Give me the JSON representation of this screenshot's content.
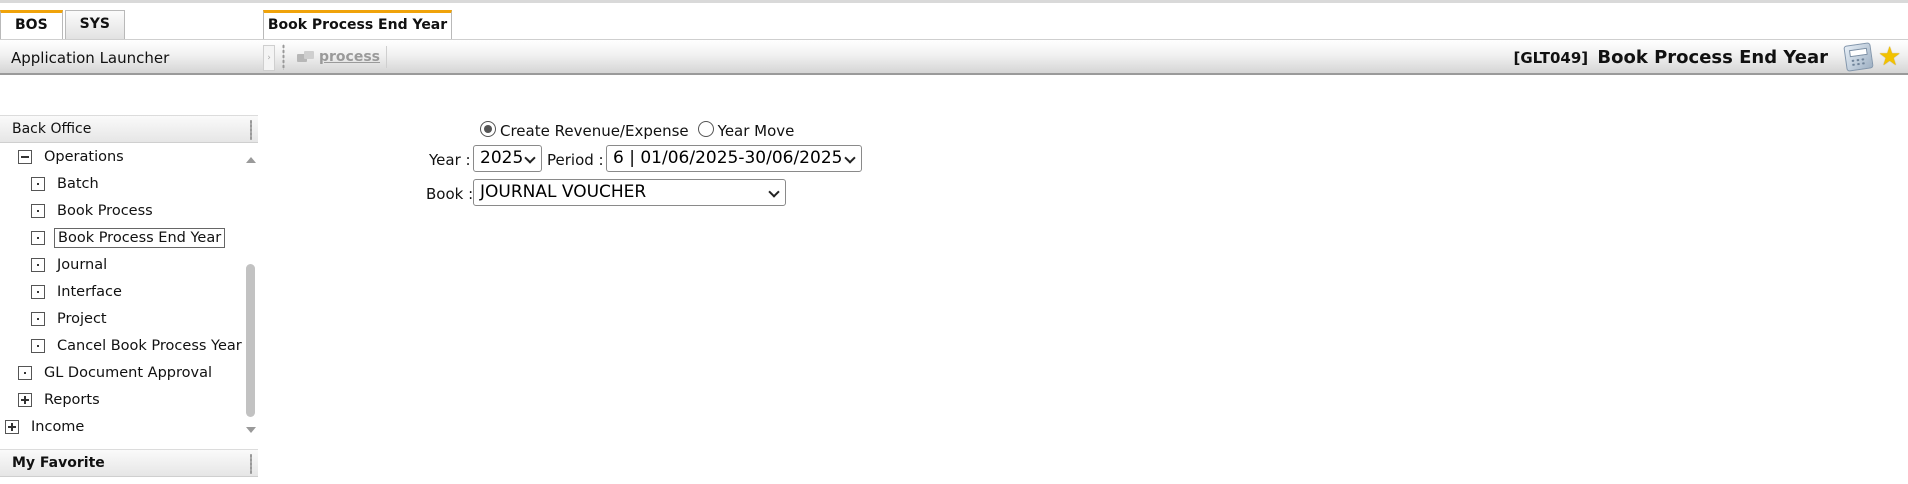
{
  "tabs": {
    "left": [
      {
        "label": "BOS",
        "active": true
      },
      {
        "label": "SYS",
        "active": false
      }
    ],
    "right": {
      "label": "Book Process End Year"
    }
  },
  "header": {
    "launcher": "Application Launcher",
    "process_button": "process",
    "page_code": "[GLT049]",
    "page_title": "Book Process End Year",
    "icons": [
      "calculator-icon",
      "star-icon"
    ],
    "accent_color": "#f0a30a"
  },
  "sidebar": {
    "section_title": "Back Office",
    "items": [
      {
        "label": "Operations",
        "toggle": "minus"
      },
      {
        "label": "Batch",
        "toggle": "leaf"
      },
      {
        "label": "Book Process",
        "toggle": "leaf"
      },
      {
        "label": "Book Process End Year",
        "toggle": "leaf",
        "selected": true
      },
      {
        "label": "Journal",
        "toggle": "leaf"
      },
      {
        "label": "Interface",
        "toggle": "leaf"
      },
      {
        "label": "Project",
        "toggle": "leaf"
      },
      {
        "label": "Cancel Book Process Year",
        "toggle": "leaf"
      },
      {
        "label": "GL Document Approval",
        "toggle": "leaf"
      },
      {
        "label": "Reports",
        "toggle": "plus"
      },
      {
        "label": "Income",
        "toggle": "plus"
      }
    ],
    "favorite_title": "My Favorite"
  },
  "form": {
    "radio_options": [
      {
        "label": "Create Revenue/Expense",
        "checked": true
      },
      {
        "label": "Year Move",
        "checked": false
      }
    ],
    "year_label": "Year :",
    "year_value": "2025",
    "period_label": "Period :",
    "period_value": "6 | 01/06/2025-30/06/2025",
    "book_label": "Book :",
    "book_value": "JOURNAL VOUCHER"
  }
}
